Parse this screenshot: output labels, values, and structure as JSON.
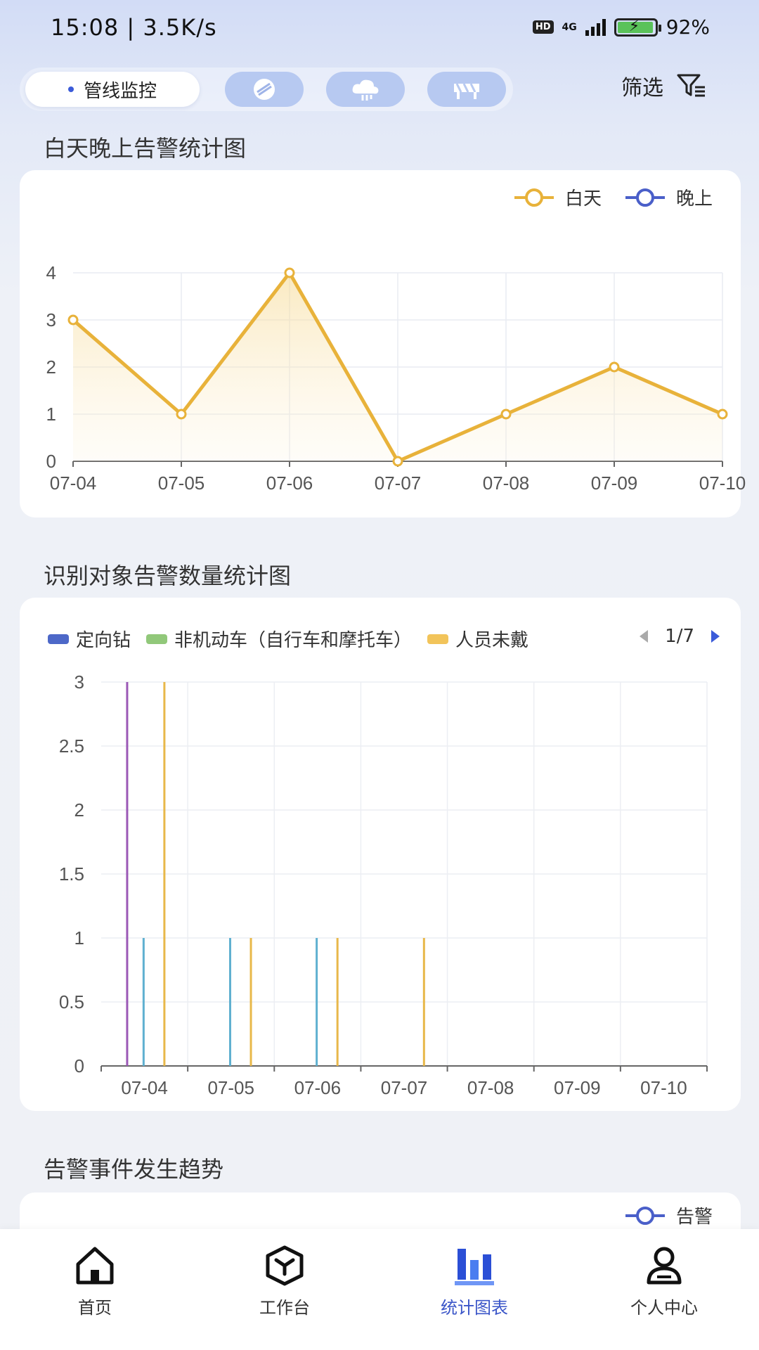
{
  "status_bar": {
    "time": "15:08 | 3.5K/s",
    "hd": "HD",
    "network": "4G",
    "battery": "92%"
  },
  "tabs": {
    "active_label": "管线监控",
    "icons": [
      "pipeline-sensor-icon",
      "cloud-oil-icon",
      "barrier-icon"
    ]
  },
  "filter": {
    "label": "筛选"
  },
  "chart1": {
    "title": "白天晚上告警统计图",
    "legend": [
      "白天",
      "晚上"
    ]
  },
  "chart2": {
    "title": "识别对象告警数量统计图",
    "legend": [
      "定向钻",
      "非机动车（自行车和摩托车）",
      "人员未戴"
    ],
    "page": "1/7"
  },
  "section3": {
    "title": "告警事件发生趋势",
    "legend": [
      "告警"
    ]
  },
  "bottom_nav": [
    "首页",
    "工作台",
    "统计图表",
    "个人中心"
  ],
  "chart_data": [
    {
      "type": "line",
      "title": "白天晚上告警统计图",
      "x": [
        "07-04",
        "07-05",
        "07-06",
        "07-07",
        "07-08",
        "07-09",
        "07-10"
      ],
      "series": [
        {
          "name": "白天",
          "values": [
            3,
            1,
            4,
            0,
            1,
            2,
            1
          ],
          "color": "#e8b23a"
        },
        {
          "name": "晚上",
          "values": [],
          "color": "#4a5fc9"
        }
      ],
      "ylim": [
        0,
        4
      ],
      "yticks": [
        "0",
        "1",
        "2",
        "3",
        "4"
      ],
      "grid": true,
      "legend_position": "top-right"
    },
    {
      "type": "bar",
      "title": "识别对象告警数量统计图",
      "categories": [
        "07-04",
        "07-05",
        "07-06",
        "07-07",
        "07-08",
        "07-09",
        "07-10"
      ],
      "series": [
        {
          "name": "",
          "values": [
            3,
            0,
            0,
            0,
            0,
            0,
            0
          ],
          "color": "#9b59b6"
        },
        {
          "name": "",
          "values": [
            1,
            1,
            1,
            0,
            0,
            0,
            0
          ],
          "color": "#5fb0d0"
        },
        {
          "name": "",
          "values": [
            3,
            1,
            1,
            1,
            0,
            0,
            0
          ],
          "color": "#e8b84a"
        }
      ],
      "ylim": [
        0,
        3
      ],
      "yticks": [
        "0",
        "0.5",
        "1",
        "1.5",
        "2",
        "2.5",
        "3"
      ],
      "grid": true,
      "legend_position": "top"
    }
  ]
}
